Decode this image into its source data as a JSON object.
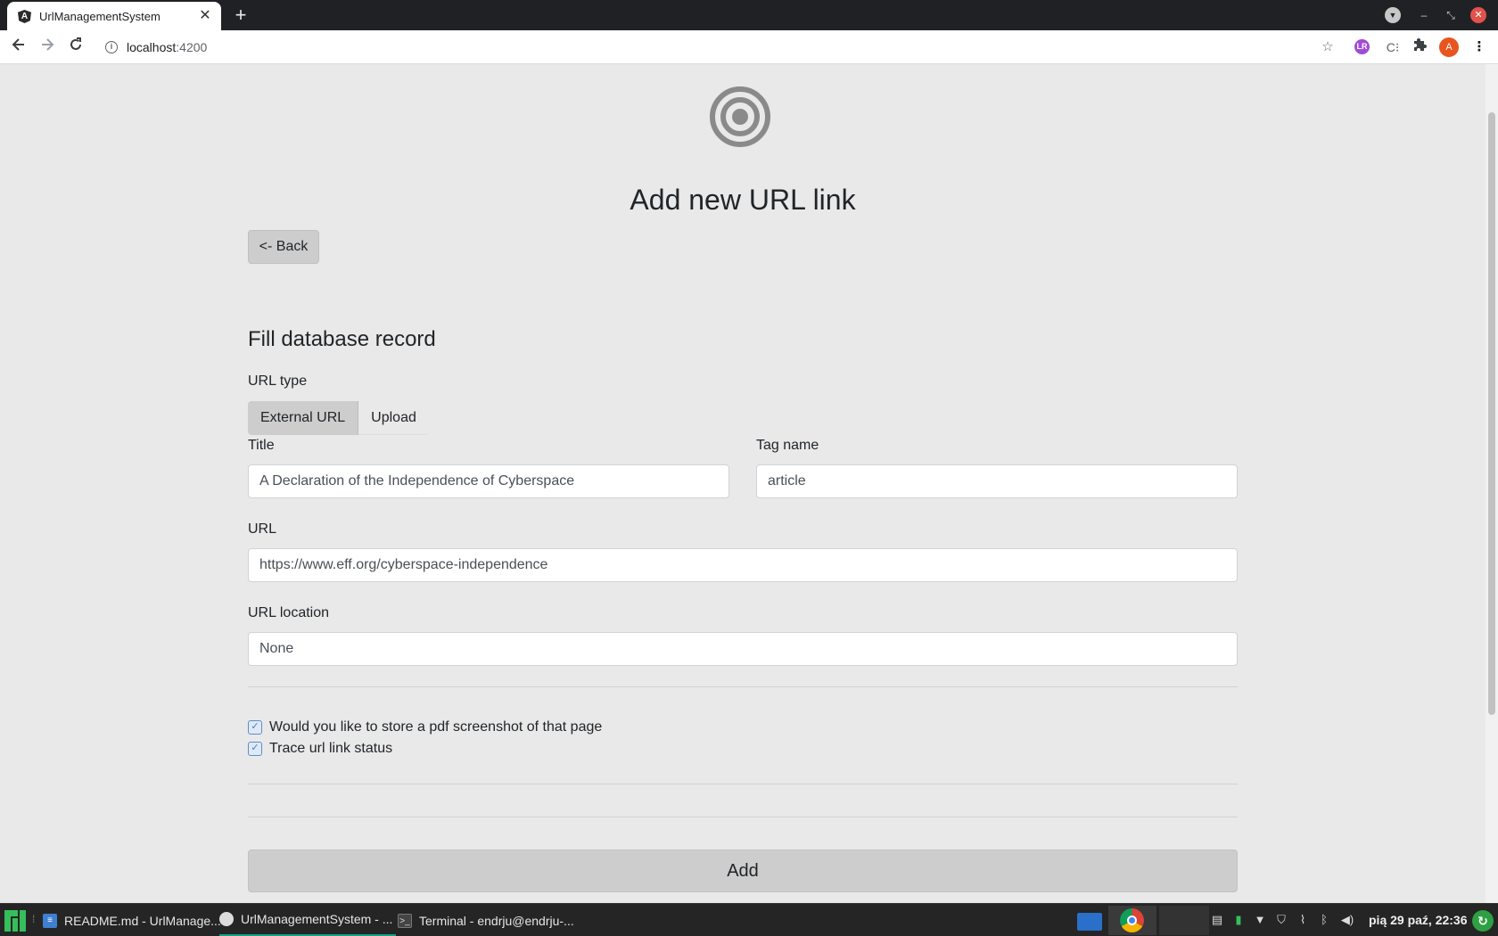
{
  "browser": {
    "tab_title": "UrlManagementSystem",
    "tab_close": "✕",
    "new_tab": "+",
    "url_host": "localhost",
    "url_port": ":4200",
    "profile_initial": "A",
    "extension_lr": "LR",
    "icons": [
      "angular-favicon",
      "back-arrow-icon",
      "forward-arrow-icon",
      "reload-icon",
      "info-icon",
      "star-icon",
      "puzzle-icon",
      "menu-dots-icon"
    ]
  },
  "page": {
    "title": "Add new URL link",
    "back_button": "<- Back",
    "section_title": "Fill database record",
    "url_type_label": "URL type",
    "url_type_options": [
      "External URL",
      "Upload"
    ],
    "url_type_selected": "External URL",
    "fields": {
      "title_label": "Title",
      "title_value": "A Declaration of the Independence of Cyberspace",
      "tag_label": "Tag name",
      "tag_value": "article",
      "url_label": "URL",
      "url_value": "https://www.eff.org/cyberspace-independence",
      "location_label": "URL location",
      "location_value": "None"
    },
    "checkboxes": [
      {
        "label": "Would you like to store a pdf screenshot of that page",
        "checked": true
      },
      {
        "label": "Trace url link status",
        "checked": true
      }
    ],
    "add_button": "Add"
  },
  "taskbar": {
    "tasks": [
      "README.md - UrlManage...",
      "UrlManagementSystem - ...",
      "Terminal - endrju@endrju-..."
    ],
    "active_task": "UrlManagementSystem - ...",
    "clock": "pią 29 paź, 22:36"
  },
  "colors": {
    "page_background": "#e9e9e9",
    "button_gray": "#cdcdcd",
    "tab_bar": "#202124",
    "taskbar": "#252525",
    "active_task_accent": "#16a085"
  }
}
